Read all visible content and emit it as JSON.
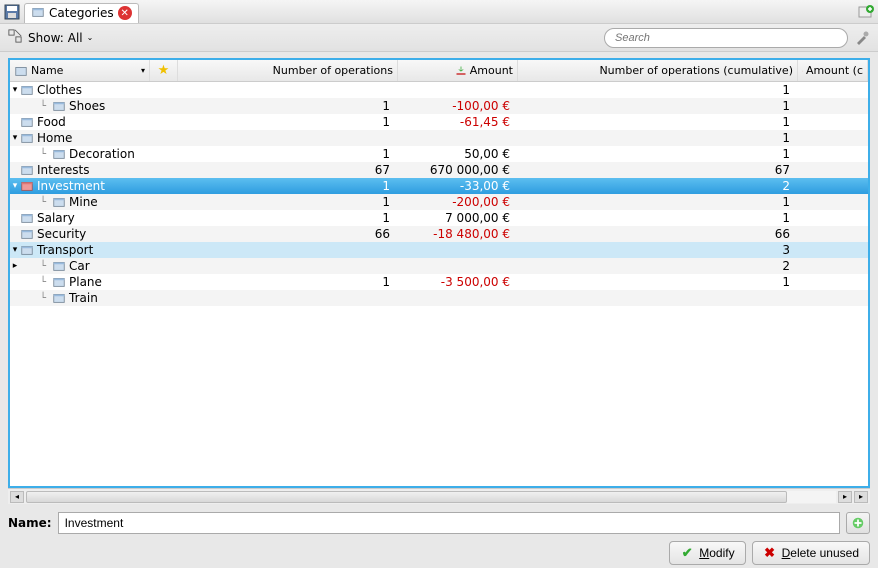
{
  "tab": {
    "title": "Categories"
  },
  "filter": {
    "show_label": "Show:",
    "show_value": "All",
    "search_placeholder": "Search"
  },
  "columns": {
    "name": "Name",
    "ops": "Number of operations",
    "amount": "Amount",
    "opscum": "Number of operations (cumulative)",
    "amountcum": "Amount (c"
  },
  "rows": [
    {
      "depth": 0,
      "expander": "v",
      "icon": "cat",
      "name": "Clothes",
      "ops": "",
      "amount": "",
      "opscum": "1",
      "zebra": false
    },
    {
      "depth": 1,
      "expander": "",
      "icon": "cat",
      "name": "Shoes",
      "ops": "1",
      "amount": "-100,00 €",
      "neg": true,
      "opscum": "1",
      "zebra": true
    },
    {
      "depth": 0,
      "expander": "",
      "icon": "cat",
      "name": "Food",
      "ops": "1",
      "amount": "-61,45 €",
      "neg": true,
      "opscum": "1",
      "zebra": false
    },
    {
      "depth": 0,
      "expander": "v",
      "icon": "cat",
      "name": "Home",
      "ops": "",
      "amount": "",
      "opscum": "1",
      "zebra": true
    },
    {
      "depth": 1,
      "expander": "",
      "icon": "cat",
      "name": "Decoration",
      "ops": "1",
      "amount": "50,00 €",
      "opscum": "1",
      "zebra": false
    },
    {
      "depth": 0,
      "expander": "",
      "icon": "cat",
      "name": "Interests",
      "ops": "67",
      "amount": "670 000,00 €",
      "opscum": "67",
      "zebra": true
    },
    {
      "depth": 0,
      "expander": "v",
      "icon": "cat-red",
      "name": "Investment",
      "ops": "1",
      "amount": "-33,00 €",
      "neg": true,
      "opscum": "2",
      "selected": true
    },
    {
      "depth": 1,
      "expander": "",
      "icon": "cat",
      "name": "Mine",
      "ops": "1",
      "amount": "-200,00 €",
      "neg": true,
      "opscum": "1",
      "zebra": true
    },
    {
      "depth": 0,
      "expander": "",
      "icon": "cat",
      "name": "Salary",
      "ops": "1",
      "amount": "7 000,00 €",
      "opscum": "1",
      "zebra": false
    },
    {
      "depth": 0,
      "expander": "",
      "icon": "cat",
      "name": "Security",
      "ops": "66",
      "amount": "-18 480,00 €",
      "neg": true,
      "opscum": "66",
      "zebra": true
    },
    {
      "depth": 0,
      "expander": "v",
      "icon": "cat",
      "name": "Transport",
      "ops": "",
      "amount": "",
      "opscum": "3",
      "hover": true
    },
    {
      "depth": 1,
      "expander": ">",
      "icon": "cat",
      "name": "Car",
      "ops": "",
      "amount": "",
      "opscum": "2",
      "zebra": true
    },
    {
      "depth": 1,
      "expander": "",
      "icon": "cat",
      "name": "Plane",
      "ops": "1",
      "amount": "-3 500,00 €",
      "neg": true,
      "opscum": "1",
      "zebra": false
    },
    {
      "depth": 1,
      "expander": "",
      "icon": "cat",
      "name": "Train",
      "ops": "",
      "amount": "",
      "opscum": "",
      "zebra": true
    }
  ],
  "name_field": {
    "label": "Name:",
    "value": "Investment"
  },
  "buttons": {
    "modify": "Modify",
    "delete_unused": "Delete unused"
  }
}
